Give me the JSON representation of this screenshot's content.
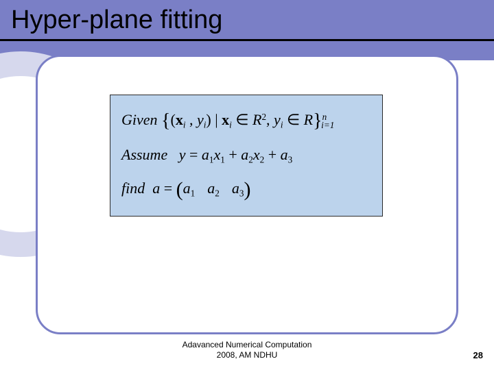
{
  "title": "Hyper-plane fitting",
  "math": {
    "line1": {
      "given": "Given",
      "x": "x",
      "y_i": "y",
      "R2": "R",
      "R": "R",
      "n": "n",
      "i1": "i=1"
    },
    "line2": {
      "assume": "Assume",
      "y": "y",
      "eq": "=",
      "a1": "a",
      "x1": "x",
      "plus": "+",
      "a2": "a",
      "x2": "x",
      "a3": "a"
    },
    "line3": {
      "find": "find",
      "a": "a",
      "eq": "=",
      "a1": "a",
      "a2": "a",
      "a3": "a"
    }
  },
  "footer": {
    "line1": "Adavanced Numerical Computation",
    "line2": "2008, AM NDHU"
  },
  "page": "28"
}
